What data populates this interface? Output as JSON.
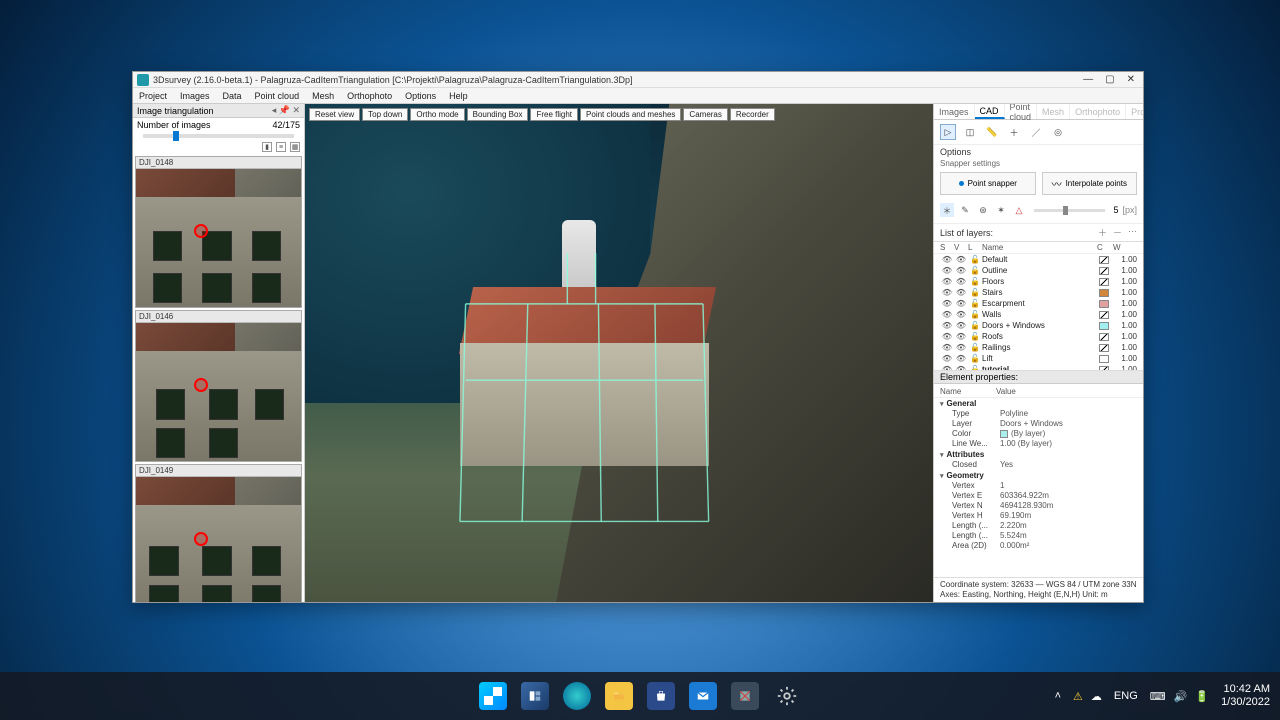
{
  "window": {
    "title": "3Dsurvey (2.16.0-beta.1) - Palagruza-CadItemTriangulation [C:\\Projekti\\Palagruza\\Palagruza-CadItemTriangulation.3Dp]"
  },
  "menus": [
    "Project",
    "Images",
    "Data",
    "Point cloud",
    "Mesh",
    "Orthophoto",
    "Options",
    "Help"
  ],
  "left": {
    "title": "Image triangulation",
    "countLabel": "Number of images",
    "countValue": "42/175",
    "thumbs": [
      {
        "label": "DJI_0148"
      },
      {
        "label": "DJI_0146"
      },
      {
        "label": "DJI_0149"
      }
    ]
  },
  "viewport": {
    "buttons": [
      "Reset view",
      "Top down",
      "Ortho mode",
      "Bounding Box",
      "Free flight",
      "Point clouds and meshes",
      "Cameras",
      "Recorder"
    ]
  },
  "rightTabs": [
    "Images",
    "CAD",
    "Point cloud",
    "Mesh",
    "Orthophoto",
    "Profile"
  ],
  "cad": {
    "optionsLabel": "Options",
    "snapperLabel": "Snapper settings",
    "pointSnapper": "Point snapper",
    "interpolate": "Interpolate points",
    "sliderVal": "5",
    "sliderUnit": "[px]",
    "layersTitle": "List of layers:",
    "cols": {
      "s": "S",
      "v": "V",
      "l": "L",
      "name": "Name",
      "c": "C",
      "w": "W"
    },
    "layers": [
      {
        "name": "Default",
        "color": "#ffffff",
        "colorStripe": true,
        "w": "1.00"
      },
      {
        "name": "Outline",
        "color": "#ffffff",
        "colorStripe": true,
        "w": "1.00"
      },
      {
        "name": "Floors",
        "color": "#ffffff",
        "colorStripe": true,
        "w": "1.00"
      },
      {
        "name": "Stairs",
        "color": "#d2873a",
        "w": "1.00"
      },
      {
        "name": "Escarpment",
        "color": "#e0a0a0",
        "w": "1.00"
      },
      {
        "name": "Walls",
        "color": "#ffffff",
        "colorStripe": true,
        "w": "1.00"
      },
      {
        "name": "Doors + Windows",
        "color": "#a0f0f0",
        "w": "1.00"
      },
      {
        "name": "Roofs",
        "color": "#ffffff",
        "colorStripe": true,
        "w": "1.00"
      },
      {
        "name": "Railings",
        "color": "#ffffff",
        "colorStripe": true,
        "w": "1.00"
      },
      {
        "name": "Lift",
        "color": "#ffffff",
        "w": "1.00"
      },
      {
        "name": "tutorial",
        "color": "#ffffff",
        "colorStripe": true,
        "w": "1.00",
        "bold": true
      }
    ]
  },
  "props": {
    "title": "Element properties:",
    "nameCol": "Name",
    "valueCol": "Value",
    "general": {
      "label": "General",
      "rows": [
        {
          "k": "Type",
          "v": "Polyline"
        },
        {
          "k": "Layer",
          "v": "Doors + Windows"
        },
        {
          "k": "Color",
          "v": "(By layer)",
          "swatch": true
        },
        {
          "k": "Line We...",
          "v": "1.00 (By layer)"
        }
      ]
    },
    "attributes": {
      "label": "Attributes",
      "rows": [
        {
          "k": "Closed",
          "v": "Yes"
        }
      ]
    },
    "geometry": {
      "label": "Geometry",
      "rows": [
        {
          "k": "Vertex",
          "v": "1"
        },
        {
          "k": "Vertex E",
          "v": "603364.922m"
        },
        {
          "k": "Vertex N",
          "v": "4694128.930m"
        },
        {
          "k": "Vertex H",
          "v": "69.190m"
        },
        {
          "k": "Length (...",
          "v": "2.220m"
        },
        {
          "k": "Length (...",
          "v": "5.524m"
        },
        {
          "k": "Area (2D)",
          "v": "0.000m²"
        }
      ]
    }
  },
  "status": {
    "line1": "Coordinate system: 32633 — WGS 84 / UTM zone 33N",
    "line2": "Axes: Easting, Northing, Height (E,N,H) Unit: m"
  },
  "taskbar": {
    "lang": "ENG",
    "time": "10:42 AM",
    "date": "1/30/2022"
  }
}
